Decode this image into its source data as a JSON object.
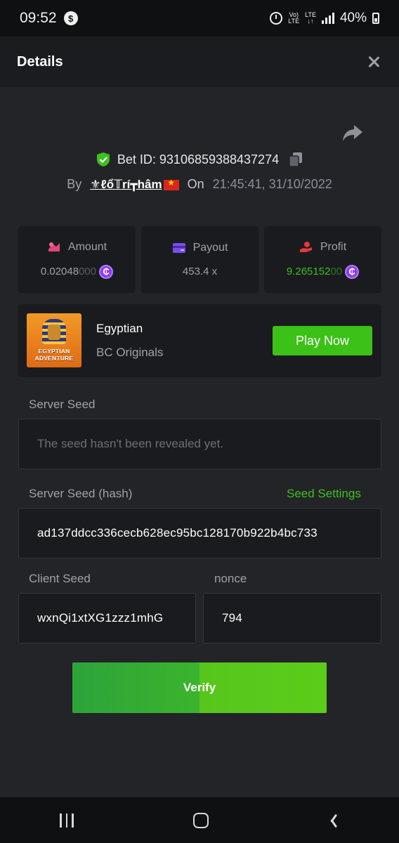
{
  "status_bar": {
    "time": "09:52",
    "network_top": "Vo)",
    "network_bottom": "LTE",
    "lte_top": "LTE",
    "lte_bottom": "↓↑",
    "battery": "40%"
  },
  "header": {
    "title": "Details"
  },
  "bet": {
    "id_label": "Bet ID: 93106859388437274",
    "by_label": "By",
    "username": "⚜ℓổ𝕋rí┳hâm",
    "on_label": "On",
    "datetime": "21:45:41, 31/10/2022"
  },
  "stats": {
    "amount": {
      "label": "Amount",
      "value": "0.02048",
      "value_dim": "000"
    },
    "payout": {
      "label": "Payout",
      "value": "453.4 x"
    },
    "profit": {
      "label": "Profit",
      "value": "9.265152",
      "value_dim": "00"
    }
  },
  "game": {
    "name": "Egyptian",
    "provider": "BC Originals",
    "thumb_line1": "EGYPTIAN",
    "thumb_line2": "ADVENTURE",
    "play_label": "Play Now"
  },
  "seeds": {
    "server_seed_label": "Server Seed",
    "server_seed_placeholder": "The seed hasn't been revealed yet.",
    "server_hash_label": "Server Seed (hash)",
    "seed_settings_label": "Seed Settings",
    "server_hash_value": "ad137ddcc336cecb628ec95bc128170b922b4bc733",
    "client_seed_label": "Client Seed",
    "client_seed_value": "wxnQi1xtXG1zzz1mhG",
    "nonce_label": "nonce",
    "nonce_value": "794"
  },
  "verify": {
    "label": "Verify"
  },
  "colors": {
    "accent_green": "#3bc117",
    "coin_purple": "#8b3cf0",
    "amount_icon": "#e0457a",
    "payout_icon": "#7b4cf0",
    "profit_icon": "#e03a3a"
  }
}
